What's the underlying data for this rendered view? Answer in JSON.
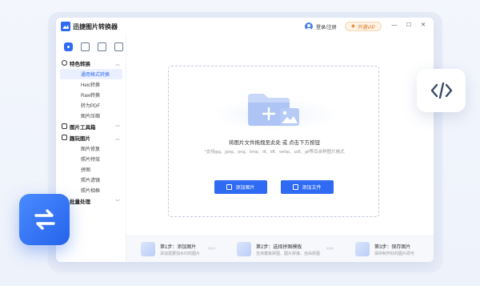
{
  "app": {
    "title": "迅捷图片转换器"
  },
  "titlebar": {
    "login_label": "登录/注册",
    "vip_label": "开通VIP",
    "minimize": "—",
    "maximize": "☐",
    "close": "✕"
  },
  "sidebar": {
    "sections": [
      {
        "label": "特色转换",
        "items": [
          "通用格式转换",
          "Heic转换",
          "Raw转换",
          "转为PDF",
          "图片压缩"
        ]
      },
      {
        "label": "图片工具箱",
        "items": []
      },
      {
        "label": "趣玩图片",
        "items": [
          "图片修复",
          "照片特效",
          "拼图",
          "照片滤镜",
          "照片相框"
        ]
      },
      {
        "label": "批量处理",
        "items": []
      }
    ]
  },
  "dropzone": {
    "instruction": "将图片文件拖拽至此处 或 点击下方按钮",
    "formats": "*支持jpg、jpeg、png、bmp、tif、tiff、webp、pdf、gif等百余种图片格式",
    "add_image_label": "添加图片",
    "add_file_label": "添加文件"
  },
  "steps": [
    {
      "title": "第1步：添加图片",
      "desc": "添加需要加水印的图片"
    },
    {
      "title": "第2步：选择拼图模板",
      "desc": "支持模板拼图、图片拼接、自由拼图"
    },
    {
      "title": "第3步：保存图片",
      "desc": "保存制作好的图片即可"
    }
  ],
  "colors": {
    "accent": "#2f6af2",
    "vip": "#d9741b",
    "convert_badge": "#2563eb"
  },
  "icons": {
    "app_logo": "app-logo-icon",
    "code": "code-brackets-icon",
    "convert": "swap-arrows-icon",
    "folder": "folder-image-icon"
  }
}
